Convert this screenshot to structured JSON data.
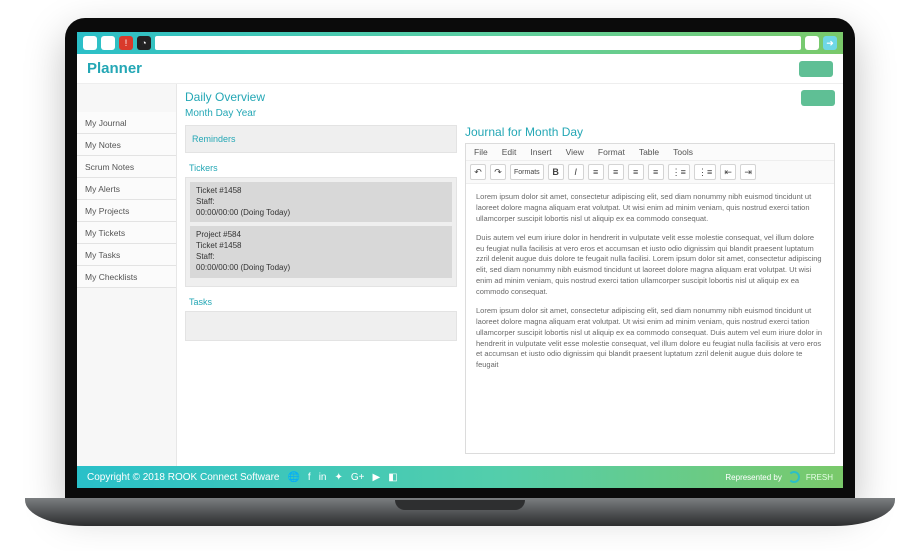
{
  "app_title": "Planner",
  "overview_title": "Daily Overview",
  "date_line": "Month Day Year",
  "search_placeholder": "",
  "sidebar": {
    "items": [
      {
        "label": "My Journal"
      },
      {
        "label": "My Notes"
      },
      {
        "label": "Scrum Notes"
      },
      {
        "label": "My Alerts"
      },
      {
        "label": "My Projects"
      },
      {
        "label": "My Tickets"
      },
      {
        "label": "My Tasks"
      },
      {
        "label": "My Checklists"
      }
    ]
  },
  "left_column": {
    "reminders_label": "Reminders",
    "tickers_label": "Tickers",
    "tasks_label": "Tasks",
    "tickers": [
      {
        "title": "Ticket #1458",
        "staff": "Staff:",
        "time": "00:00/00:00 (Doing Today)"
      },
      {
        "title": "Project #584",
        "sub": "Ticket #1458",
        "staff": "Staff:",
        "time": "00:00/00:00 (Doing Today)"
      }
    ]
  },
  "journal": {
    "heading": "Journal for Month Day",
    "menu": [
      "File",
      "Edit",
      "Insert",
      "View",
      "Format",
      "Table",
      "Tools"
    ],
    "toolbar": {
      "undo": "undo",
      "redo": "redo",
      "formats": "Formats",
      "bold": "B",
      "italic": "I"
    },
    "paragraphs": [
      "Lorem ipsum dolor sit amet, consectetur adipiscing elit, sed diam nonummy nibh euismod tincidunt ut laoreet dolore magna aliquam erat volutpat. Ut wisi enim ad minim veniam, quis nostrud exerci tation ullamcorper suscipit lobortis nisl ut aliquip ex ea commodo consequat.",
      "Duis autem vel eum iriure dolor in hendrerit in vulputate velit esse molestie consequat, vel illum dolore eu feugiat nulla facilisis at vero eros et accumsan et iusto odio dignissim qui blandit praesent luptatum zzril delenit augue duis dolore te feugait nulla facilisi. Lorem ipsum dolor sit amet, consectetur adipiscing elit, sed diam nonummy nibh euismod tincidunt ut laoreet dolore magna aliquam erat volutpat. Ut wisi enim ad minim veniam, quis nostrud exerci tation ullamcorper suscipit lobortis nisl ut aliquip ex ea commodo consequat.",
      "Lorem ipsum dolor sit amet, consectetur adipiscing elit, sed diam nonummy nibh euismod tincidunt ut laoreet dolore magna aliquam erat volutpat. Ut wisi enim ad minim veniam, quis nostrud exerci tation ullamcorper suscipit lobortis nisl ut aliquip ex ea commodo consequat. Duis autem vel eum iriure dolor in hendrerit in vulputate velit esse molestie consequat, vel illum dolore eu feugiat nulla facilisis at vero eros et accumsan et iusto odio dignissim qui blandit praesent luptatum zzril delenit augue duis dolore te feugait"
    ]
  },
  "footer": {
    "copyright": "Copyright © 2018 ROOK Connect Software",
    "represented": "Represented by",
    "brand": "FRESH"
  }
}
